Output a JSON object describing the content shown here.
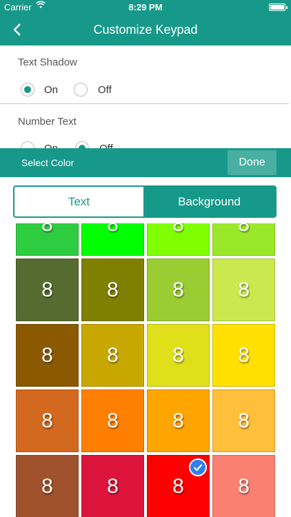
{
  "status_bar": {
    "carrier": "Carrier",
    "time": "8:29 PM"
  },
  "nav": {
    "title": "Customize Keypad",
    "back_icon": "chevron-left-icon"
  },
  "text_shadow": {
    "label": "Text Shadow",
    "on_label": "On",
    "off_label": "Off",
    "selected": "On"
  },
  "number_text": {
    "label": "Number Text",
    "on_label": "On",
    "off_label": "Off",
    "selected": "Off"
  },
  "color_sheet": {
    "title": "Select Color",
    "done_label": "Done",
    "tabs": [
      {
        "label": "Text"
      },
      {
        "label": "Background"
      }
    ],
    "active_tab": "Background",
    "digit": "8",
    "swatches": [
      {
        "color": "#2ecc40"
      },
      {
        "color": "#00ff00"
      },
      {
        "color": "#7fff00"
      },
      {
        "color": "#9ae82a"
      },
      {
        "color": "#556b2f"
      },
      {
        "color": "#808000"
      },
      {
        "color": "#9acd32"
      },
      {
        "color": "#cbe84e"
      },
      {
        "color": "#8b5a00"
      },
      {
        "color": "#c8a800"
      },
      {
        "color": "#e0e01a"
      },
      {
        "color": "#ffe000"
      },
      {
        "color": "#d2691e"
      },
      {
        "color": "#ff7f00"
      },
      {
        "color": "#ffa500"
      },
      {
        "color": "#ffbf3a"
      },
      {
        "color": "#a0522d"
      },
      {
        "color": "#dc143c"
      },
      {
        "color": "#ff0000",
        "selected": true
      },
      {
        "color": "#fa8072"
      }
    ]
  }
}
